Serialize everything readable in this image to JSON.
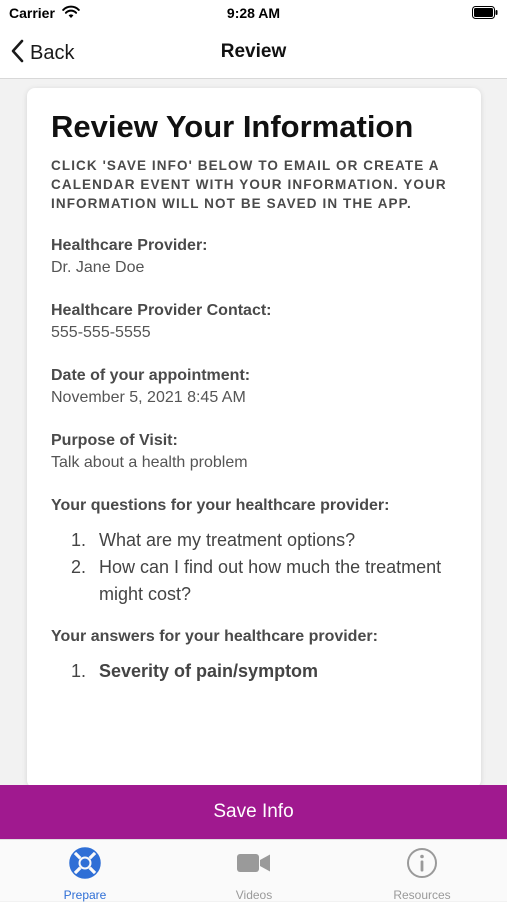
{
  "status_bar": {
    "carrier": "Carrier",
    "time": "9:28 AM"
  },
  "nav": {
    "back_label": "Back",
    "title": "Review"
  },
  "card": {
    "title": "Review Your Information",
    "instructions": "CLICK 'SAVE INFO' BELOW TO EMAIL OR CREATE A CALENDAR EVENT WITH YOUR INFORMATION. YOUR INFORMATION WILL NOT BE SAVED IN THE APP.",
    "fields": [
      {
        "label": "Healthcare Provider:",
        "value": "Dr. Jane Doe"
      },
      {
        "label": "Healthcare Provider Contact:",
        "value": "555-555-5555"
      },
      {
        "label": "Date of your appointment:",
        "value": "November 5, 2021 8:45 AM"
      },
      {
        "label": "Purpose of Visit:",
        "value": "Talk about a health problem"
      }
    ],
    "questions_heading": "Your questions for your healthcare provider:",
    "questions": [
      {
        "num": "1.",
        "text": "What are my treatment options?"
      },
      {
        "num": "2.",
        "text": "How can I find out how much the treatment might cost?"
      }
    ],
    "answers_heading": "Your answers for your healthcare provider:",
    "answers": [
      {
        "num": "1.",
        "text": "Severity of pain/symptom"
      }
    ]
  },
  "save_button": {
    "label": "Save Info",
    "color": "#a0198f"
  },
  "tab_bar": {
    "active_color": "#2f6fd6",
    "inactive_color": "#9a9a9a",
    "tabs": [
      {
        "label": "Prepare",
        "icon": "lifebuoy-icon",
        "active": true
      },
      {
        "label": "Videos",
        "icon": "video-camera-icon",
        "active": false
      },
      {
        "label": "Resources",
        "icon": "info-circle-icon",
        "active": false
      }
    ]
  }
}
